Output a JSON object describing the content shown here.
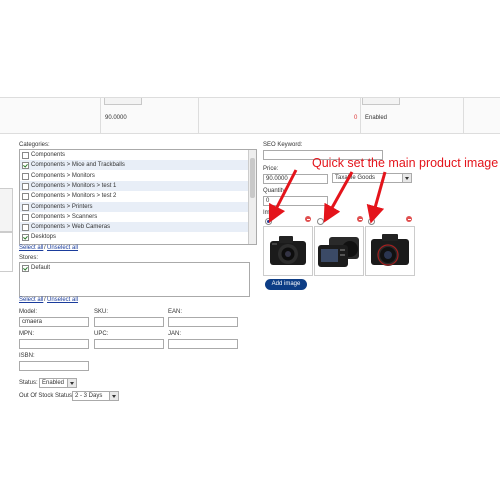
{
  "grid": {
    "price": "90.0000",
    "quantity": "0",
    "status": "Enabled"
  },
  "categories": {
    "label": "Categories:",
    "items": [
      {
        "label": "Components",
        "checked": false
      },
      {
        "label": "Components > Mice and Trackballs",
        "checked": true
      },
      {
        "label": "Components > Monitors",
        "checked": false
      },
      {
        "label": "Components > Monitors > test 1",
        "checked": false
      },
      {
        "label": "Components > Monitors > test 2",
        "checked": false
      },
      {
        "label": "Components > Printers",
        "checked": false
      },
      {
        "label": "Components > Scanners",
        "checked": false
      },
      {
        "label": "Components > Web Cameras",
        "checked": false
      },
      {
        "label": "Desktops",
        "checked": true
      }
    ],
    "select_all": "Select all",
    "sep": "/",
    "unselect_all": "Unselect all"
  },
  "stores": {
    "label": "Stores:",
    "items": [
      {
        "label": "Default",
        "checked": true
      }
    ],
    "select_all": "Select all",
    "sep": "/",
    "unselect_all": "Unselect all"
  },
  "fields": {
    "model_label": "Model:",
    "model_value": "cmaera",
    "sku_label": "SKU:",
    "ean_label": "EAN:",
    "mpn_label": "MPN:",
    "upc_label": "UPC:",
    "jan_label": "JAN:",
    "isbn_label": "ISBN:",
    "status_label": "Status:",
    "status_value": "Enabled",
    "oos_label": "Out Of Stock Status:",
    "oos_value": "2 - 3 Days"
  },
  "right": {
    "seo_label": "SEO Keyword:",
    "price_label": "Price:",
    "price_value": "90.0000",
    "tax_value": "Taxable Goods",
    "quantity_label": "Quantity:",
    "quantity_value": "0",
    "image_label": "Image:",
    "add_image": "Add image"
  },
  "annotation": {
    "text": "Quick set the main product image",
    "color": "#e4141b"
  },
  "images": [
    {
      "main": true,
      "icon": "camera-image"
    },
    {
      "main": false,
      "icon": "camera-back-image"
    },
    {
      "main": false,
      "icon": "camera-lens-image"
    }
  ]
}
